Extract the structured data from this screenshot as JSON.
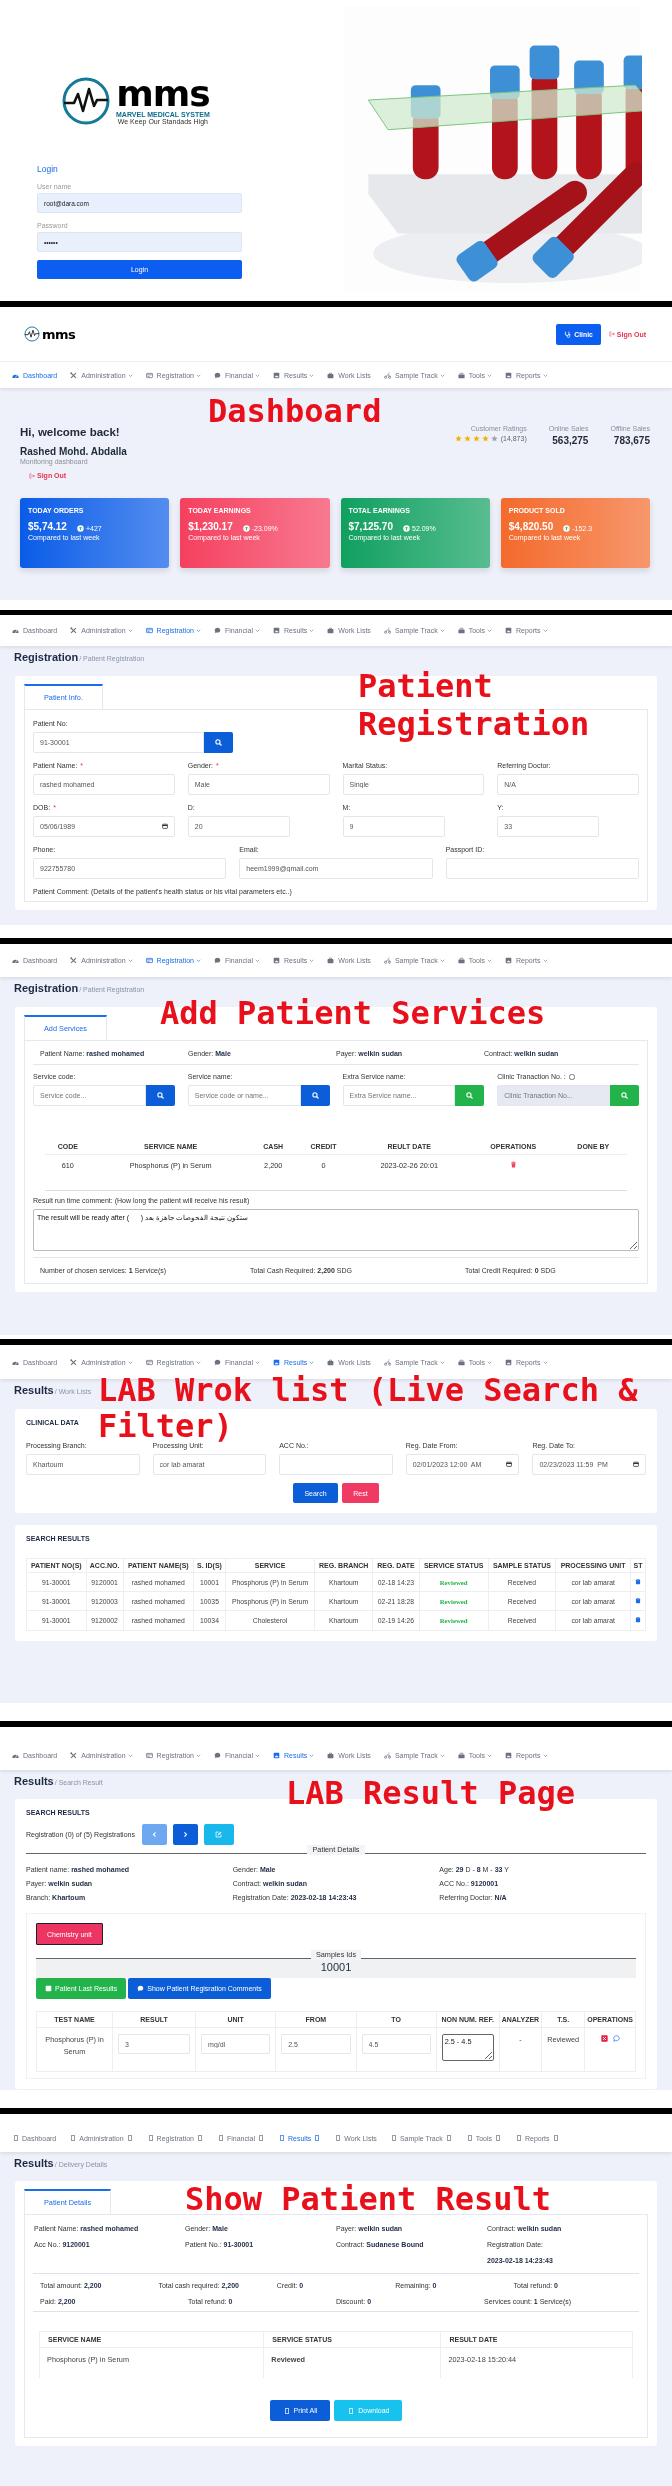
{
  "screens": [
    {
      "kind": "login",
      "logo": {
        "wordmark": "mms",
        "name": "MARVEL MEDICAL SYSTEM",
        "tagline": "We Keep Our Standads High"
      },
      "title": "Login",
      "fields": [
        {
          "label": "User name",
          "value": "root@dara.com"
        },
        {
          "label": "Password",
          "value": "••••••"
        }
      ],
      "button": "Login",
      "image": {
        "kind": "picture"
      }
    },
    {
      "kind": "dashboard",
      "annotation": "Dashboard",
      "icons_missing": false,
      "header": {
        "logo": "mms",
        "clinic_button": "Clinic",
        "sign_out": "Sign Out"
      },
      "nav": {
        "items": [
          {
            "label": "Dashboard",
            "selected": true,
            "dropdown": false
          },
          {
            "label": "Administration",
            "selected": false,
            "dropdown": true
          },
          {
            "label": "Registration",
            "selected": false,
            "dropdown": true
          },
          {
            "label": "Financial",
            "selected": false,
            "dropdown": true
          },
          {
            "label": "Results",
            "selected": false,
            "dropdown": true
          },
          {
            "label": "Work Lists",
            "selected": false,
            "dropdown": false
          },
          {
            "label": "Sample Track",
            "selected": false,
            "dropdown": true
          },
          {
            "label": "Tools",
            "selected": false,
            "dropdown": true
          },
          {
            "label": "Reports",
            "selected": false,
            "dropdown": true
          }
        ]
      },
      "welcome": "Hi, welcome back!",
      "user": "Rashed Mohd. Abdalla",
      "subtitle": "Monitoring dashboard",
      "sign_out": "Sign Out",
      "ratings": {
        "label": "Customer Ratings",
        "stars": 4,
        "count": "(14,873)"
      },
      "stats": [
        {
          "label": "Online Sales",
          "value": "563,275"
        },
        {
          "label": "Offline Sales",
          "value": "783,675"
        }
      ],
      "cards": [
        {
          "title": "TODAY ORDERS",
          "amount": "$5,74.12",
          "change": "+427",
          "note": "Compared to last week",
          "color": "#0a5ce8"
        },
        {
          "title": "TODAY EARNINGS",
          "amount": "$1,230.17",
          "change": "-23.09%",
          "note": "Compared to last week",
          "color": "#f5405f"
        },
        {
          "title": "TOTAL EARNINGS",
          "amount": "$7,125.70",
          "change": "52.09%",
          "note": "Compared to last week",
          "color": "#10a060"
        },
        {
          "title": "PRODUCT SOLD",
          "amount": "$4,820.50",
          "change": "-152.3",
          "note": "Compared to last week",
          "color": "#f46a2c"
        }
      ]
    },
    {
      "kind": "registration",
      "annotation": "Patient Registration",
      "icons_missing": false,
      "nav": {
        "items": [
          {
            "label": "Dashboard",
            "selected": false,
            "dropdown": false
          },
          {
            "label": "Administration",
            "selected": false,
            "dropdown": true
          },
          {
            "label": "Registration",
            "selected": true,
            "dropdown": true
          },
          {
            "label": "Financial",
            "selected": false,
            "dropdown": true
          },
          {
            "label": "Results",
            "selected": false,
            "dropdown": true
          },
          {
            "label": "Work Lists",
            "selected": false,
            "dropdown": false
          },
          {
            "label": "Sample Track",
            "selected": false,
            "dropdown": true
          },
          {
            "label": "Tools",
            "selected": false,
            "dropdown": true
          },
          {
            "label": "Reports",
            "selected": false,
            "dropdown": true
          }
        ]
      },
      "title": "Registration",
      "breadcrumb": "/ Patient Registration",
      "tabs": [
        {
          "label": "Patient Info.",
          "selected": true
        }
      ],
      "rows": [
        {
          "fields": [
            {
              "label": "Patient No:",
              "value": "91-30001",
              "kind": "search"
            }
          ]
        },
        {
          "fields": [
            {
              "label": "Patient Name:",
              "mark": "*",
              "value": "rashed mohamed",
              "kind": "text"
            },
            {
              "label": "Gender:",
              "mark": "*",
              "value": "Male",
              "kind": "text"
            },
            {
              "label": "Marital Status:",
              "value": "Single",
              "kind": "text"
            },
            {
              "label": "Referring Doctor:",
              "value": "N/A",
              "kind": "text"
            }
          ]
        },
        {
          "fields": [
            {
              "label": "DOB:",
              "mark": "*",
              "value": "05/06/1989",
              "kind": "date"
            },
            {
              "label": "D:",
              "value": "20",
              "kind": "short"
            },
            {
              "label": "M:",
              "value": "9",
              "kind": "short"
            },
            {
              "label": "Y:",
              "value": "33",
              "kind": "short"
            }
          ]
        },
        {
          "fields": [
            {
              "label": "Phone:",
              "value": "922755780",
              "kind": "text"
            },
            {
              "label": "Email:",
              "value": "heem1999@gmail.com",
              "kind": "text"
            },
            {
              "label": "Passport ID:",
              "kind": "text"
            }
          ]
        }
      ],
      "comment_label": "Patient Comment: (Details of the patient's health status or his vital parameters etc..)"
    },
    {
      "kind": "services",
      "annotation": "Add Patient Services",
      "icons_missing": false,
      "nav": {
        "items": [
          {
            "label": "Dashboard",
            "selected": false,
            "dropdown": false
          },
          {
            "label": "Administration",
            "selected": false,
            "dropdown": true
          },
          {
            "label": "Registration",
            "selected": true,
            "dropdown": true
          },
          {
            "label": "Financial",
            "selected": false,
            "dropdown": true
          },
          {
            "label": "Results",
            "selected": false,
            "dropdown": true
          },
          {
            "label": "Work Lists",
            "selected": false,
            "dropdown": false
          },
          {
            "label": "Sample Track",
            "selected": false,
            "dropdown": true
          },
          {
            "label": "Tools",
            "selected": false,
            "dropdown": true
          },
          {
            "label": "Reports",
            "selected": false,
            "dropdown": true
          }
        ]
      },
      "title": "Registration",
      "breadcrumb": "/ Patient Registration",
      "tabs": [
        {
          "label": "Add Services",
          "selected": true
        }
      ],
      "info": [
        "Patient Name: **rashed mohamed**",
        "Gender: **Male**",
        "Payer: **welkin sudan**",
        "Contract: **welkin sudan**"
      ],
      "searches": [
        {
          "label": "Service code:",
          "placeholder": "Service code...",
          "color": "#0b5ed7",
          "disabled": false
        },
        {
          "label": "Service name:",
          "placeholder": "Service code or name...",
          "color": "#0b5ed7",
          "disabled": false
        },
        {
          "label": "Extra Service name:",
          "placeholder": "Extra Service name...",
          "color": "#22b44a",
          "disabled": false
        },
        {
          "label": "Clinic Tranaction No. :",
          "placeholder": "Clinic Tranaction No...",
          "color": "#22b44a",
          "disabled": true,
          "checkbox": {
            "checked": false
          }
        }
      ],
      "table": {
        "columns": [
          "CODE",
          "SERVICE NAME",
          "CASH",
          "CREDIT",
          "REULT DATE",
          "OPERATIONS",
          "DONE BY"
        ],
        "rows": [
          {
            "cells": [
              "610",
              "Phosphorus (P) in Serum",
              "2,200",
              "0",
              "2023-02-26 20:01"
            ]
          }
        ]
      },
      "comment": {
        "label": "Result run time comment: (How long the patient will receive his result)",
        "value": "The result will be ready after (      ) ستكون نتيجة الفحوصات جاهزة بعد"
      },
      "footer": [
        "Number of chosen services: **1** Service(s)",
        "Total Cash Required: **2,200** SDG",
        "Total Credit Required: **0** SDG"
      ]
    },
    {
      "kind": "worklist",
      "annotation": "LAB Wrok list (Live Search & Filter)",
      "icons_missing": false,
      "nav": {
        "items": [
          {
            "label": "Dashboard",
            "selected": false,
            "dropdown": false
          },
          {
            "label": "Administration",
            "selected": false,
            "dropdown": true
          },
          {
            "label": "Registration",
            "selected": false,
            "dropdown": true
          },
          {
            "label": "Financial",
            "selected": false,
            "dropdown": true
          },
          {
            "label": "Results",
            "selected": true,
            "dropdown": true
          },
          {
            "label": "Work Lists",
            "selected": false,
            "dropdown": false
          },
          {
            "label": "Sample Track",
            "selected": false,
            "dropdown": true
          },
          {
            "label": "Tools",
            "selected": false,
            "dropdown": true
          },
          {
            "label": "Reports",
            "selected": false,
            "dropdown": true
          }
        ]
      },
      "title": "Results",
      "breadcrumb": "/ Work Lists",
      "filter": {
        "title": "CLINICAL DATA",
        "fields": [
          {
            "label": "Processing Branch:",
            "value": "Khartoum",
            "kind": "text"
          },
          {
            "label": "Processing Unit:",
            "value": "cor lab amarat",
            "kind": "text"
          },
          {
            "label": "ACC No.:",
            "kind": "text"
          },
          {
            "label": "Reg. Date From:",
            "value": "02/01/2023 12:00  AM",
            "kind": "date"
          },
          {
            "label": "Reg. Date To:",
            "value": "02/23/2023 11:59  PM",
            "kind": "date"
          }
        ],
        "buttons": [
          {
            "label": "Search",
            "color": "#0b5ed7"
          },
          {
            "label": "Rest",
            "color": "#f03a64"
          }
        ]
      },
      "results": {
        "title": "SEARCH RESULTS",
        "columns": [
          {
            "label": "PATIENT NO(S)",
            "kind": "text"
          },
          {
            "label": "ACC.NO.",
            "kind": "text"
          },
          {
            "label": "PATIENT NAME(S)",
            "kind": "text"
          },
          {
            "label": "S. ID(S)",
            "kind": "text"
          },
          {
            "label": "SERVICE",
            "kind": "text"
          },
          {
            "label": "REG. BRANCH",
            "kind": "text"
          },
          {
            "label": "REG. DATE",
            "kind": "text"
          },
          {
            "label": "SERVICE STATUS",
            "kind": "status"
          },
          {
            "label": "SAMPLE STATUS",
            "kind": "text"
          },
          {
            "label": "PROCESSING UNIT",
            "kind": "text"
          },
          {
            "label": "ST",
            "kind": "icon"
          }
        ],
        "rows": [
          {
            "cells": [
              "91-30001",
              "9120001",
              "rashed mohamed",
              "10001",
              "Phosphorus (P) in Serum",
              "Khartoum",
              "02-18 14:23",
              "Reviewed",
              "Received",
              "cor lab amarat"
            ]
          },
          {
            "cells": [
              "91-30001",
              "9120003",
              "rashed mohamed",
              "10035",
              "Phosphorus (P) in Serum",
              "Khartoum",
              "02-21 18:28",
              "Reviewed",
              "Received",
              "cor lab amarat"
            ]
          },
          {
            "cells": [
              "91-30001",
              "9120002",
              "rashed mohamed",
              "10034",
              "Cholesterol",
              "Khartoum",
              "02-19 14:26",
              "Reviewed",
              "Received",
              "cor lab amarat"
            ]
          }
        ]
      }
    },
    {
      "kind": "result",
      "annotation": "LAB Result Page",
      "icons_missing": false,
      "nav": {
        "items": [
          {
            "label": "Dashboard",
            "selected": false,
            "dropdown": false
          },
          {
            "label": "Administration",
            "selected": false,
            "dropdown": true
          },
          {
            "label": "Registration",
            "selected": false,
            "dropdown": true
          },
          {
            "label": "Financial",
            "selected": false,
            "dropdown": true
          },
          {
            "label": "Results",
            "selected": true,
            "dropdown": true
          },
          {
            "label": "Work Lists",
            "selected": false,
            "dropdown": false
          },
          {
            "label": "Sample Track",
            "selected": false,
            "dropdown": true
          },
          {
            "label": "Tools",
            "selected": false,
            "dropdown": true
          },
          {
            "label": "Reports",
            "selected": false,
            "dropdown": true
          }
        ]
      },
      "title": "Results",
      "breadcrumb": "/ Search Result",
      "section_title": "SEARCH RESULTS",
      "pager": "Registration (0) of (5) Registrations",
      "pager_buttons": [
        {
          "kind": "prev",
          "disabled": true
        },
        {
          "kind": "next",
          "disabled": false
        },
        {
          "kind": "edit",
          "disabled": false
        }
      ],
      "legend": "Patient Details",
      "details": [
        "Patient name: **rashed mohamed**",
        "Gender: **Male**",
        "Age: **29** D - **8** M - **33** Y",
        "Payer: **welkin sudan**",
        "Contract: **welkin sudan**",
        "ACC No.: **9120001**",
        "Branch: **Khartoum**",
        "Registration Date: **2023-02-18 14:23:43**",
        "Referring Doctor: **N/A**"
      ],
      "unit_button": "Chemistry unit",
      "samples": {
        "legend": "Samples Ids",
        "ids": "10001"
      },
      "actions": [
        {
          "label": "Patient Last Results",
          "color": "#22b44a"
        },
        {
          "label": "Show Patient Regisration Comments",
          "color": "#0b5ed7"
        }
      ],
      "tests": {
        "columns": [
          "TEST NAME",
          "RESULT",
          "UNIT",
          "FROM",
          "TO",
          "NON NUM. REF.",
          "ANALYZER",
          "T.S.",
          "OPERATIONS"
        ],
        "rows": [
          {
            "name": "Phosphorus (P) in Serum",
            "result": "3",
            "unit": "mg/dl",
            "from": "2.5",
            "to": "4.5",
            "reference": "2.5 - 4.5",
            "analyzer": "-",
            "status": "Reviewed"
          }
        ]
      }
    },
    {
      "kind": "delivery",
      "annotation": "Show Patient Result",
      "icons_missing": true,
      "nav": {
        "items": [
          {
            "label": "Dashboard",
            "selected": false,
            "dropdown": false
          },
          {
            "label": "Administration",
            "selected": false,
            "dropdown": true
          },
          {
            "label": "Registration",
            "selected": false,
            "dropdown": true
          },
          {
            "label": "Financial",
            "selected": false,
            "dropdown": true
          },
          {
            "label": "Results",
            "selected": true,
            "dropdown": true
          },
          {
            "label": "Work Lists",
            "selected": false,
            "dropdown": false
          },
          {
            "label": "Sample Track",
            "selected": false,
            "dropdown": true
          },
          {
            "label": "Tools",
            "selected": false,
            "dropdown": true
          },
          {
            "label": "Reports",
            "selected": false,
            "dropdown": true
          }
        ]
      },
      "title": "Results",
      "breadcrumb": "/ Delivery Details",
      "tabs": [
        {
          "label": "Patient Details",
          "selected": true
        }
      ],
      "info": [
        {
          "label": "Patient Name:",
          "value": "rashed mohamed",
          "kind": "inline"
        },
        {
          "label": "Gender:",
          "value": "Male",
          "kind": "inline"
        },
        {
          "label": "Payer:",
          "value": "welkin sudan",
          "kind": "inline"
        },
        {
          "label": "Contract:",
          "value": "welkin sudan",
          "kind": "inline"
        },
        {
          "label": "Acc No.:",
          "value": "9120001",
          "kind": "inline"
        },
        {
          "label": "Patient No.:",
          "value": "91-30001",
          "kind": "inline"
        },
        {
          "label": "Contract:",
          "value": "Sudanese Bound",
          "kind": "inline"
        },
        {
          "label": "Registration Date:",
          "value": "2023-02-18 14:23:43",
          "kind": "stacked"
        }
      ],
      "totals": [
        {
          "items": [
            "Total amount: **2,200**",
            "Total cash required: **2,200**",
            "Credit: **0**",
            "Remaining: **0**",
            "Total refund: **0**"
          ]
        },
        {
          "items": [
            "Paid: **2,200**",
            "Total refund: **0**",
            "Discount: **0**",
            "Services count: **1** Service(s)"
          ]
        }
      ],
      "table": {
        "columns": [
          "SERVICE NAME",
          "SERVICE STATUS",
          "RESULT DATE"
        ],
        "rows": [
          {
            "service": "Phosphorus (P) in Serum",
            "status": "Reviewed",
            "date": "2023-02-18 15:20:44"
          }
        ]
      },
      "buttons": [
        {
          "label": "Print All",
          "color": "#0b5ed7"
        },
        {
          "label": "Download",
          "color": "#17c2ef"
        }
      ]
    }
  ]
}
